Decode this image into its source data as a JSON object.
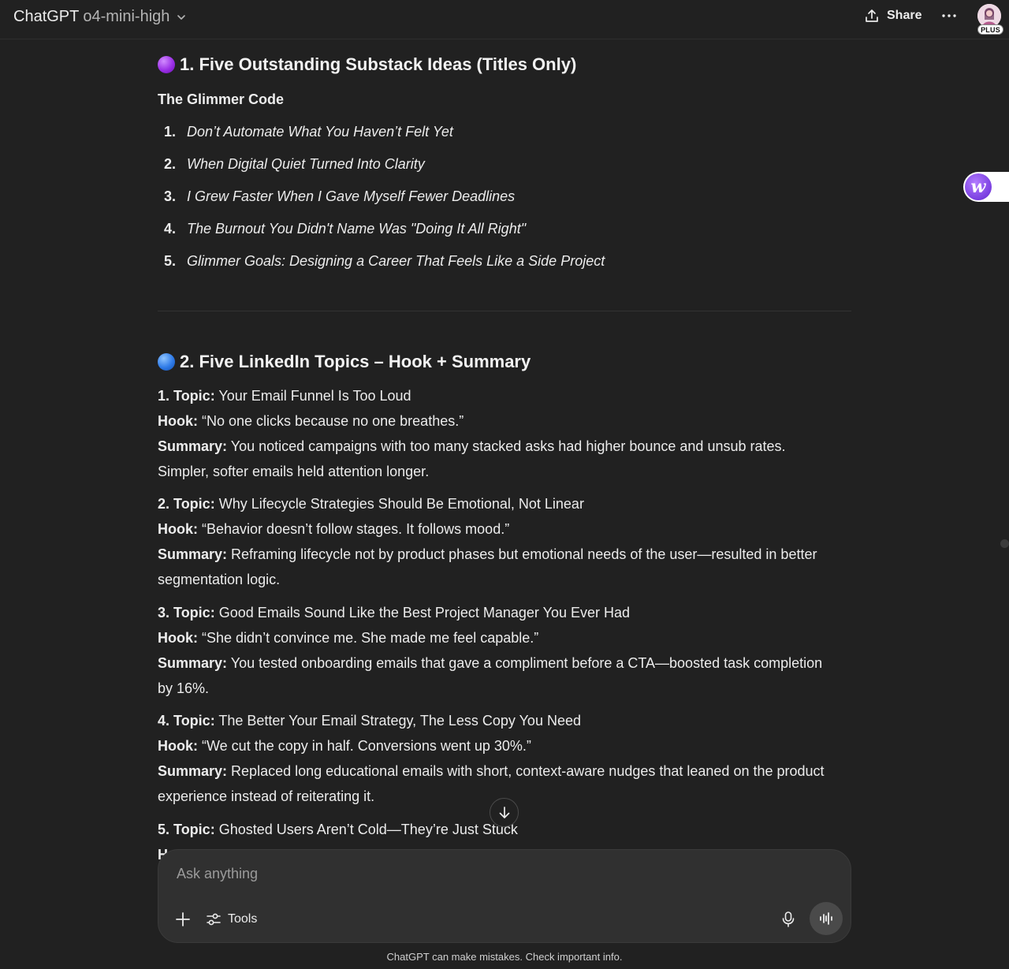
{
  "header": {
    "app_name": "ChatGPT",
    "model_name": "o4-mini-high",
    "share_label": "Share",
    "plan_badge": "PLUS"
  },
  "section1": {
    "title": "1. Five Outstanding Substack Ideas (Titles Only)",
    "icon": "purple-circle",
    "subheading": "The Glimmer Code",
    "items": [
      {
        "num": "1.",
        "text": "Don’t Automate What You Haven’t Felt Yet"
      },
      {
        "num": "2.",
        "text": "When Digital Quiet Turned Into Clarity"
      },
      {
        "num": "3.",
        "text": "I Grew Faster When I Gave Myself Fewer Deadlines"
      },
      {
        "num": "4.",
        "text": "The Burnout You Didn't Name Was \"Doing It All Right\""
      },
      {
        "num": "5.",
        "text": "Glimmer Goals: Designing a Career That Feels Like a Side Project"
      }
    ]
  },
  "section2": {
    "title": "2. Five LinkedIn Topics – Hook + Summary",
    "icon": "blue-circle",
    "topic_label": "Topic:",
    "hook_label": "Hook:",
    "summary_label": "Summary:",
    "topics": [
      {
        "num": "1.",
        "topic": "Your Email Funnel Is Too Loud",
        "hook": "“No one clicks because no one breathes.”",
        "summary_lines": [
          "You noticed campaigns with too many stacked asks had higher bounce and unsub rates.",
          "Simpler, softer emails held attention longer."
        ]
      },
      {
        "num": "2.",
        "topic": "Why Lifecycle Strategies Should Be Emotional, Not Linear",
        "hook": "“Behavior doesn’t follow stages. It follows mood.”",
        "summary_lines": [
          "Reframing lifecycle not by product phases but emotional needs of the user—resulted in better",
          "segmentation logic."
        ]
      },
      {
        "num": "3.",
        "topic": "Good Emails Sound Like the Best Project Manager You Ever Had",
        "hook": "“She didn’t convince me. She made me feel capable.”",
        "summary_lines": [
          "You tested onboarding emails that gave a compliment before a CTA—boosted task completion",
          "by 16%."
        ]
      },
      {
        "num": "4.",
        "topic": "The Better Your Email Strategy, The Less Copy You Need",
        "hook": "“We cut the copy in half. Conversions went up 30%.”",
        "summary_lines": [
          "Replaced long educational emails with short, context-aware nudges that leaned on the product",
          "experience instead of reiterating it."
        ]
      },
      {
        "num": "5.",
        "topic": "Ghosted Users Aren’t Cold—They’re Just Stuck",
        "hook_partial": "H"
      }
    ]
  },
  "composer": {
    "placeholder": "Ask anything",
    "tools_label": "Tools"
  },
  "footer": {
    "note": "ChatGPT can make mistakes. Check important info."
  },
  "side_widget": {
    "logo_letter": "w"
  }
}
